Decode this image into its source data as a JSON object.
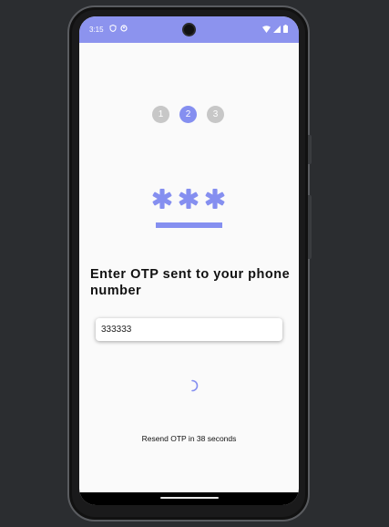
{
  "status_bar": {
    "time": "3:15",
    "icons": [
      "shield-icon",
      "circle-status-icon",
      "wifi-icon",
      "signal-icon",
      "battery-icon"
    ],
    "color": "#8c93ee"
  },
  "stepper": {
    "steps": [
      {
        "label": "1",
        "state": "inactive"
      },
      {
        "label": "2",
        "state": "active"
      },
      {
        "label": "3",
        "state": "inactive"
      }
    ],
    "active_color": "#858ff0",
    "inactive_color": "#c7c7c7"
  },
  "illustration": {
    "icon": "otp-asterisks-icon",
    "color": "#858ff0"
  },
  "heading": "Enter OTP sent to your phone number",
  "otp_input": {
    "value": "333333"
  },
  "loading": {
    "icon": "spinner-icon",
    "color": "#858ff0"
  },
  "resend_text": "Resend OTP in 38 seconds"
}
